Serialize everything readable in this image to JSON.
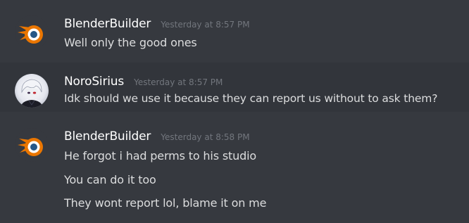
{
  "messages": [
    {
      "username": "BlenderBuilder",
      "timestamp": "Yesterday at 8:57 PM",
      "lines": [
        "Well only the good ones"
      ]
    },
    {
      "username": "NoroSirius",
      "timestamp": "Yesterday at 8:57 PM",
      "lines": [
        "Idk should we use it because they can report us without to ask them?"
      ]
    },
    {
      "username": "BlenderBuilder",
      "timestamp": "Yesterday at 8:58 PM",
      "lines": [
        "He forgot  i had perms to his studio",
        "You can do it too",
        "They wont report lol, blame it on me"
      ]
    }
  ],
  "colors": {
    "background": "#36393f",
    "highlight": "#32353b",
    "username": "#ffffff",
    "timestamp": "#72767d",
    "text": "#dcddde",
    "blender_orange": "#ea7600",
    "blender_blue": "#265787"
  },
  "icons": {
    "blender_avatar": "blender-logo-icon",
    "noro_avatar": "anime-character-avatar"
  }
}
